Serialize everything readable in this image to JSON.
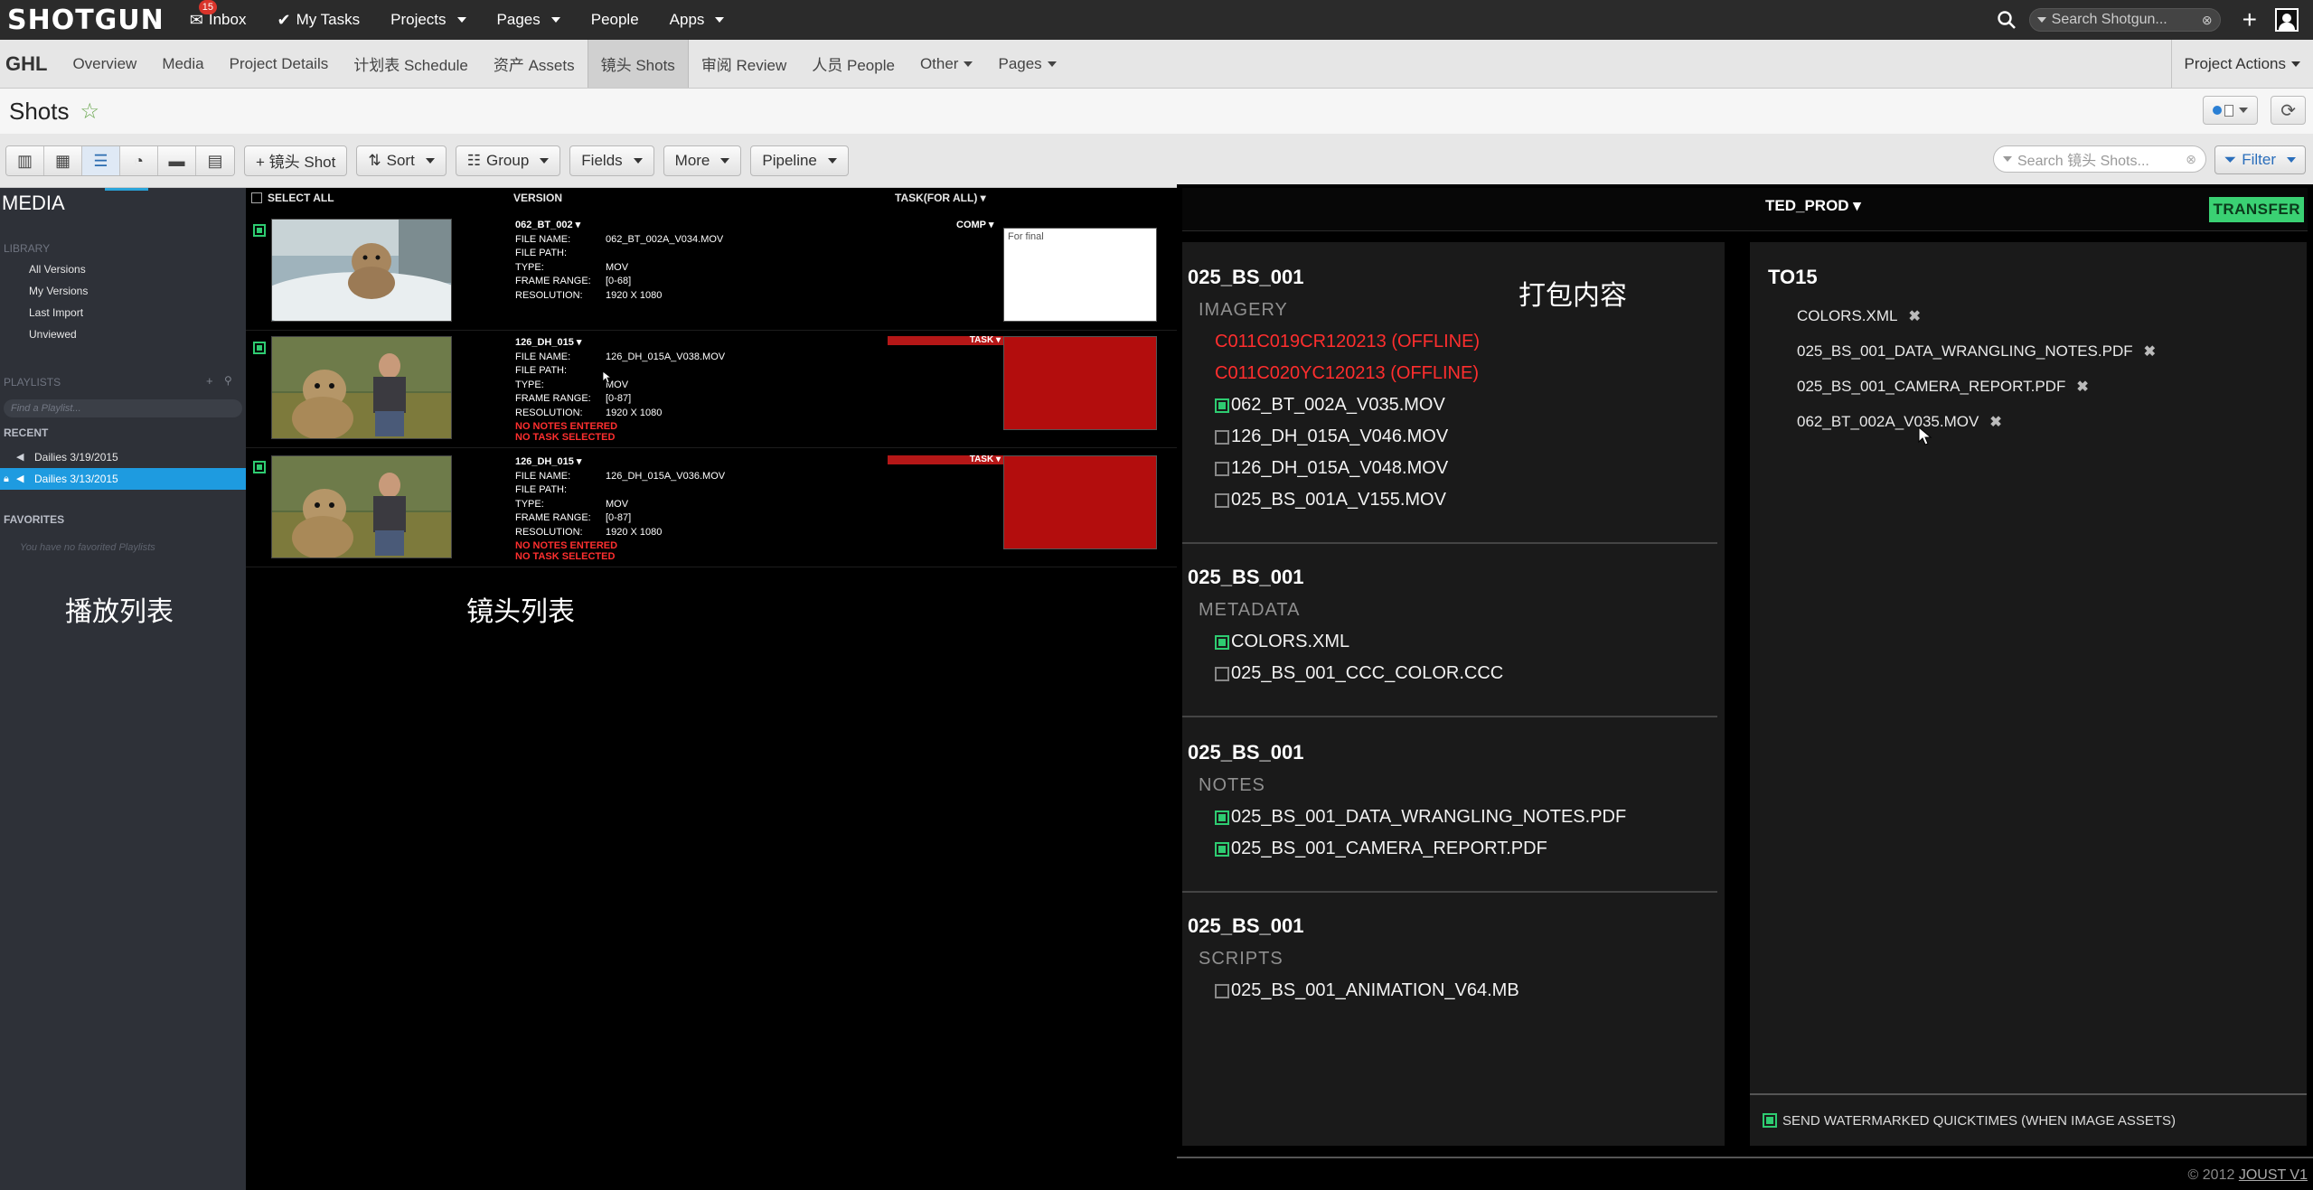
{
  "topbar": {
    "logo": "SHOTGUN",
    "nav": [
      {
        "label": "Inbox",
        "icon": "inbox-icon",
        "badge": "15"
      },
      {
        "label": "My Tasks",
        "icon": "check-circle-icon"
      },
      {
        "label": "Projects"
      },
      {
        "label": "Pages"
      },
      {
        "label": "People"
      },
      {
        "label": "Apps"
      }
    ],
    "search_placeholder": "Search Shotgun..."
  },
  "project_bar": {
    "project": "GHL",
    "tabs": [
      "Overview",
      "Media",
      "Project Details",
      "计划表 Schedule",
      "资产 Assets",
      "镜头 Shots",
      "审阅 Review",
      "人员 People",
      "Other",
      "Pages"
    ],
    "active_tab": "镜头 Shots",
    "actions": "Project Actions"
  },
  "page": {
    "title": "Shots"
  },
  "toolbar": {
    "add_shot": "+ 镜头 Shot",
    "sort": "Sort",
    "group": "Group",
    "fields": "Fields",
    "more": "More",
    "pipeline": "Pipeline",
    "search_placeholder": "Search 镜头 Shots...",
    "filter": "Filter"
  },
  "sidebar": {
    "title": "MEDIA",
    "library_label": "LIBRARY",
    "library_items": [
      "All Versions",
      "My Versions",
      "Last Import",
      "Unviewed"
    ],
    "playlists_label": "PLAYLISTS",
    "find_placeholder": "Find a Playlist...",
    "recent_label": "RECENT",
    "recent_items": [
      {
        "label": "Dailies 3/19/2015",
        "selected": false
      },
      {
        "label": "Dailies 3/13/2015",
        "selected": true
      }
    ],
    "favorites_label": "FAVORITES",
    "favorites_empty": "You have no favorited Playlists",
    "annotation": "播放列表"
  },
  "shotlist": {
    "header": {
      "select_all": "SELECT ALL",
      "version": "VERSION",
      "task": "TASK(FOR ALL) ▾"
    },
    "labels": {
      "file_name": "FILE NAME:",
      "file_path": "FILE PATH:",
      "type": "TYPE:",
      "frame_range": "FRAME RANGE:",
      "resolution": "RESOLUTION:"
    },
    "rows": [
      {
        "shot": "062_BT_002 ▾",
        "file_name": "062_BT_002A_V034.MOV",
        "file_path": "",
        "type": "MOV",
        "frame_range": "[0-68]",
        "resolution": "1920 X 1080",
        "task": "COMP ▾",
        "note": "For final",
        "warnings": []
      },
      {
        "shot": "126_DH_015 ▾",
        "file_name": "126_DH_015A_V038.MOV",
        "file_path": "",
        "type": "MOV",
        "frame_range": "[0-87]",
        "resolution": "1920 X 1080",
        "task": "TASK ▾",
        "note": "",
        "warnings": [
          "NO NOTES ENTERED",
          "NO TASK SELECTED"
        ]
      },
      {
        "shot": "126_DH_015 ▾",
        "file_name": "126_DH_015A_V036.MOV",
        "file_path": "",
        "type": "MOV",
        "frame_range": "[0-87]",
        "resolution": "1920 X 1080",
        "task": "TASK ▾",
        "note": "",
        "warnings": [
          "NO NOTES ENTERED",
          "NO TASK SELECTED"
        ]
      }
    ],
    "annotation": "镜头列表"
  },
  "transfer": {
    "title": "TED_PROD ▾",
    "transfer_button": "TRANSFER",
    "annotation": "打包内容",
    "groups": [
      {
        "shot": "025_BS_001",
        "category": "IMAGERY",
        "files": [
          {
            "name": "C011C019CR120213 (OFFLINE)",
            "offline": true,
            "checked": false
          },
          {
            "name": "C011C020YC120213 (OFFLINE)",
            "offline": true,
            "checked": false
          },
          {
            "name": "062_BT_002A_V035.MOV",
            "offline": false,
            "checked": true
          },
          {
            "name": "126_DH_015A_V046.MOV",
            "offline": false,
            "checked": false
          },
          {
            "name": "126_DH_015A_V048.MOV",
            "offline": false,
            "checked": false
          },
          {
            "name": "025_BS_001A_V155.MOV",
            "offline": false,
            "checked": false
          }
        ]
      },
      {
        "shot": "025_BS_001",
        "category": "METADATA",
        "files": [
          {
            "name": "COLORS.XML",
            "offline": false,
            "checked": true
          },
          {
            "name": "025_BS_001_CCC_COLOR.CCC",
            "offline": false,
            "checked": false
          }
        ]
      },
      {
        "shot": "025_BS_001",
        "category": "NOTES",
        "files": [
          {
            "name": "025_BS_001_DATA_WRANGLING_NOTES.PDF",
            "offline": false,
            "checked": true
          },
          {
            "name": "025_BS_001_CAMERA_REPORT.PDF",
            "offline": false,
            "checked": true
          }
        ]
      },
      {
        "shot": "025_BS_001",
        "category": "SCRIPTS",
        "files": [
          {
            "name": "025_BS_001_ANIMATION_V64.MB",
            "offline": false,
            "checked": false
          }
        ]
      }
    ],
    "destination": {
      "title": "TO15",
      "items": [
        "COLORS.XML",
        "025_BS_001_DATA_WRANGLING_NOTES.PDF",
        "025_BS_001_CAMERA_REPORT.PDF",
        "062_BT_002A_V035.MOV"
      ],
      "watermark_option": "SEND WATERMARKED QUICKTIMES (WHEN IMAGE ASSETS)"
    },
    "copyright": "© 2012",
    "copyright_link": "JOUST V1"
  }
}
